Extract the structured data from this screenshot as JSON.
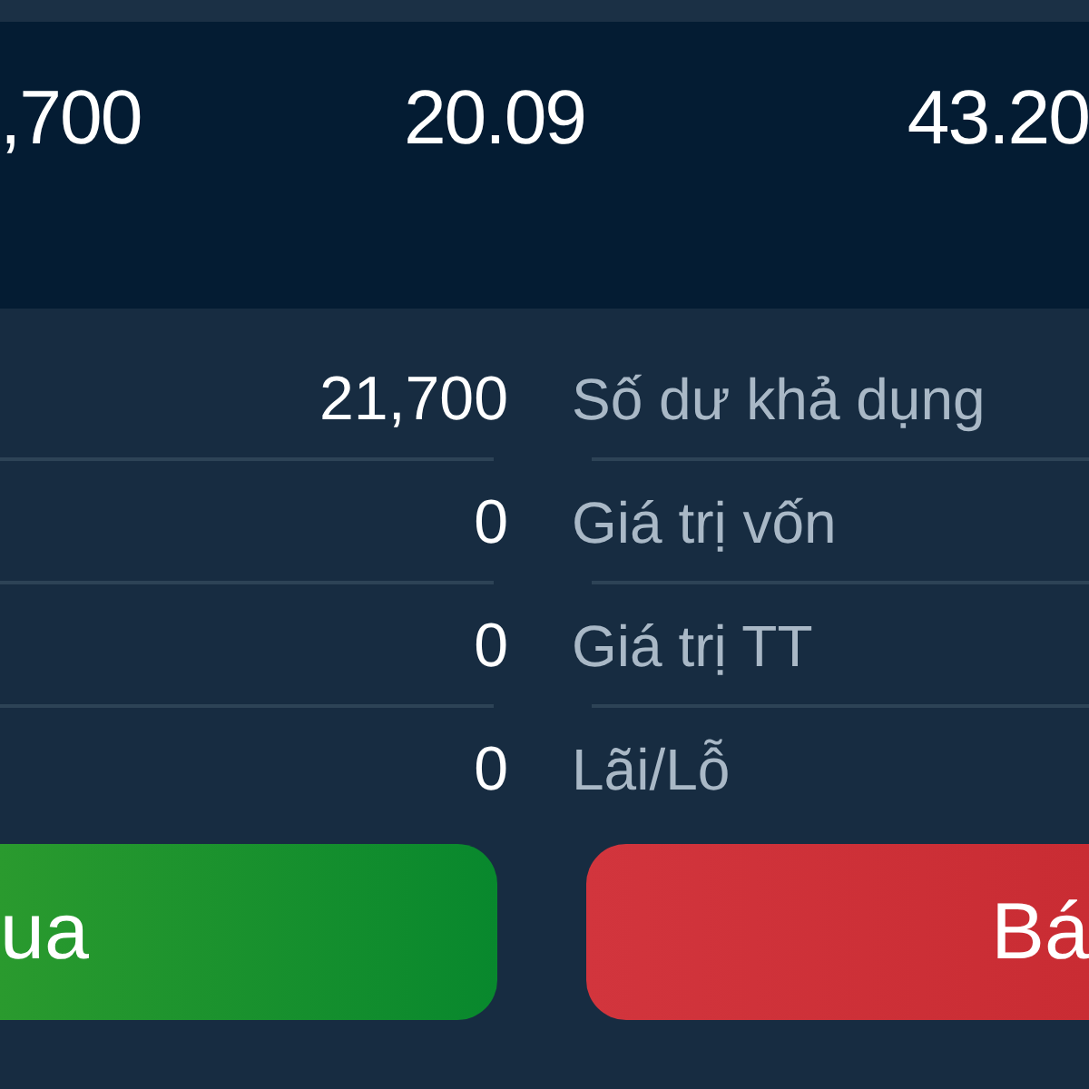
{
  "summary": {
    "values": [
      ",700",
      "20.09",
      "43.20"
    ]
  },
  "rows": [
    {
      "value": "21,700",
      "label": "Số dư khả dụng"
    },
    {
      "value": "0",
      "label": "Giá trị vốn"
    },
    {
      "value": "0",
      "label": "Giá trị TT"
    },
    {
      "value": "0",
      "label": "Lãi/Lỗ"
    }
  ],
  "actions": [
    {
      "kind": "buy",
      "label": "ua"
    },
    {
      "kind": "sell",
      "label": "Bá"
    }
  ]
}
